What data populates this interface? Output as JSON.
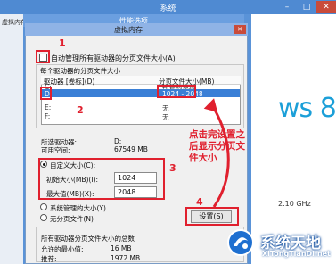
{
  "outer_window": {
    "title": "系统",
    "ctrl_min": "–",
    "ctrl_max": "□",
    "ctrl_close": "✕",
    "windows_logo_text": "ws 8",
    "cpu_speed": "2.10 GHz"
  },
  "performance_dialog": {
    "title": "性能选项",
    "left_label": "虚拟内存"
  },
  "vm_dialog": {
    "title": "虚拟内存",
    "close_label": "✕",
    "auto_manage_label": "自动管理所有驱动器的分页文件大小(A)",
    "per_drive_heading": "每个驱动器的分页文件大小",
    "col_drive": "驱动器 [卷标](D)",
    "col_size": "分页文件大小(MB)",
    "drives": [
      {
        "drive": "C:",
        "size": "托管的系统"
      },
      {
        "drive": "D:",
        "size": "1024 - 2048"
      },
      {
        "drive": "E:",
        "size": "无"
      },
      {
        "drive": "F:",
        "size": "无"
      }
    ],
    "selected_drive_label": "所选驱动器:",
    "selected_drive_value": "D:",
    "free_space_label": "可用空间:",
    "free_space_value": "67549 MB",
    "custom_size_label": "自定义大小(C):",
    "initial_size_label": "初始大小(MB)(I):",
    "initial_size_value": "1024",
    "max_size_label": "最大值(MB)(X):",
    "max_size_value": "2048",
    "system_managed_label": "系统管理的大小(Y)",
    "no_paging_label": "无分页文件(N)",
    "set_button_label": "设置(S)",
    "total_heading": "所有驱动器分页文件大小的总数",
    "min_allowed_label": "允许的最小值:",
    "min_allowed_value": "16 MB",
    "recommended_label": "推荐:",
    "recommended_value": "1972 MB"
  },
  "annotations": {
    "num1": "1",
    "num2": "2",
    "num3": "3",
    "num4": "4",
    "note_line1": "点击完设置之",
    "note_line2": "后显示分页文",
    "note_line3": "件大小",
    "color": "#e0202e"
  },
  "watermark": {
    "name_cn": "系统天地",
    "name_en": "XiTongTianDi.net"
  }
}
